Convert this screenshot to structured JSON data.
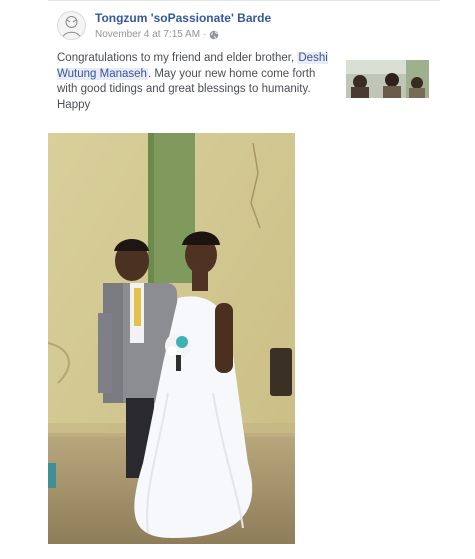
{
  "post": {
    "author": "Tongzum 'soPassionate' Barde",
    "timestamp": "November 4 at 7:15 AM",
    "separator": "·",
    "privacy_icon": "globe-icon",
    "text_before": "Congratulations to my friend and elder brother, ",
    "mention": "Deshi Wutung Manaseh",
    "text_after": ". May your new home come forth with good tidings and great blessings to humanity. Happy"
  },
  "media": {
    "thumbnail_icon": "photo-thumbnail",
    "main_photo": "wedding-couple-photo"
  },
  "colors": {
    "link": "#365899",
    "meta": "#90949c",
    "body_text": "#4b4f56",
    "mention_bg": "#e9ebf6"
  }
}
